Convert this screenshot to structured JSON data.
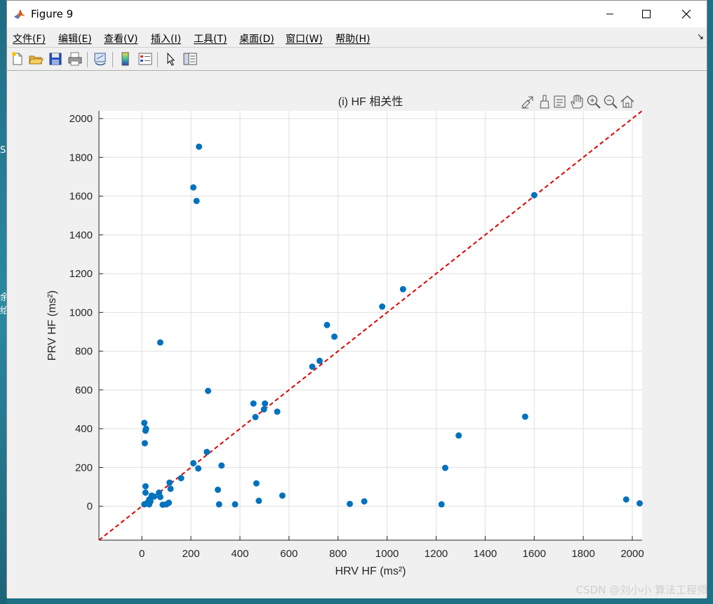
{
  "window": {
    "title": "Figure 9"
  },
  "menu": {
    "items": [
      "文件(F)",
      "编辑(E)",
      "查看(V)",
      "插入(I)",
      "工具(T)",
      "桌面(D)",
      "窗口(W)",
      "帮助(H)"
    ]
  },
  "desktop": {
    "fragments": [
      "S",
      "余",
      "给"
    ]
  },
  "watermark": "CSDN @刘小小 算法工程师",
  "chart_data": {
    "type": "scatter",
    "title": "(i) HF 相关性",
    "xlabel": "HRV HF (ms²)",
    "ylabel": "PRV HF (ms²)",
    "xlim": [
      -175,
      2040
    ],
    "ylim": [
      -175,
      2040
    ],
    "xticks": [
      0,
      200,
      400,
      600,
      800,
      1000,
      1200,
      1400,
      1600,
      1800,
      2000
    ],
    "yticks": [
      0,
      200,
      400,
      600,
      800,
      1000,
      1200,
      1400,
      1600,
      1800,
      2000
    ],
    "grid": true,
    "marker_color": "#0072BD",
    "reference_line": {
      "style": "dashed",
      "color": "#E00000",
      "from": [
        -175,
        -175
      ],
      "to": [
        2040,
        2040
      ]
    },
    "points": [
      [
        233,
        1855
      ],
      [
        210,
        1645
      ],
      [
        223,
        1575
      ],
      [
        1600,
        1605
      ],
      [
        1065,
        1120
      ],
      [
        980,
        1030
      ],
      [
        755,
        935
      ],
      [
        785,
        875
      ],
      [
        75,
        845
      ],
      [
        725,
        750
      ],
      [
        695,
        720
      ],
      [
        270,
        595
      ],
      [
        455,
        530
      ],
      [
        502,
        530
      ],
      [
        498,
        500
      ],
      [
        552,
        488
      ],
      [
        463,
        460
      ],
      [
        1563,
        462
      ],
      [
        10,
        430
      ],
      [
        17,
        400
      ],
      [
        15,
        390
      ],
      [
        1292,
        365
      ],
      [
        12,
        325
      ],
      [
        265,
        280
      ],
      [
        210,
        222
      ],
      [
        325,
        210
      ],
      [
        230,
        195
      ],
      [
        1237,
        198
      ],
      [
        160,
        145
      ],
      [
        113,
        122
      ],
      [
        467,
        118
      ],
      [
        15,
        103
      ],
      [
        117,
        90
      ],
      [
        310,
        85
      ],
      [
        15,
        70
      ],
      [
        70,
        70
      ],
      [
        40,
        55
      ],
      [
        50,
        50
      ],
      [
        75,
        48
      ],
      [
        573,
        55
      ],
      [
        30,
        35
      ],
      [
        35,
        25
      ],
      [
        25,
        20
      ],
      [
        20,
        15
      ],
      [
        10,
        10
      ],
      [
        30,
        10
      ],
      [
        85,
        8
      ],
      [
        110,
        18
      ],
      [
        100,
        10
      ],
      [
        315,
        10
      ],
      [
        380,
        10
      ],
      [
        477,
        28
      ],
      [
        848,
        12
      ],
      [
        907,
        25
      ],
      [
        1222,
        10
      ],
      [
        1975,
        35
      ],
      [
        2030,
        15
      ]
    ]
  }
}
